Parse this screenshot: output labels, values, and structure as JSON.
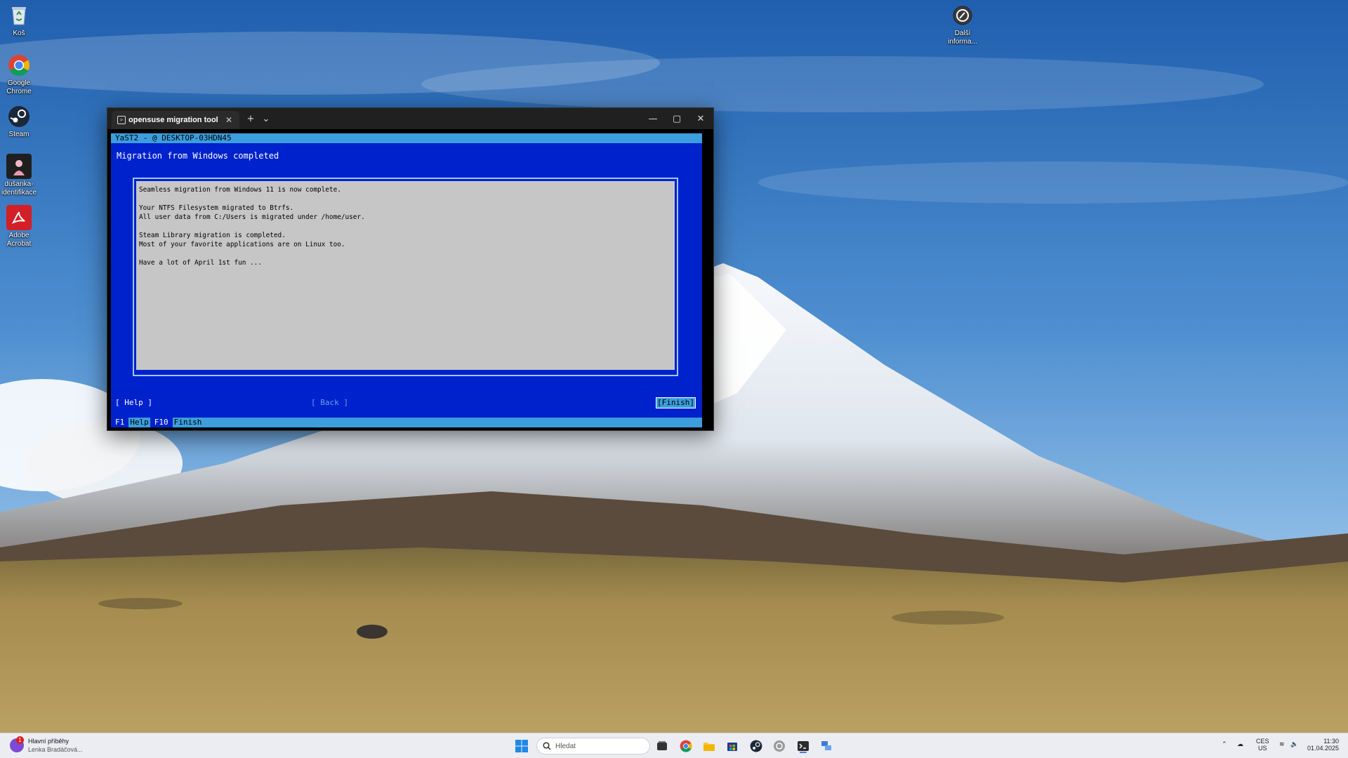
{
  "desktop": {
    "icons": [
      {
        "label": "Koš"
      },
      {
        "label": "Google Chrome"
      },
      {
        "label": "Steam"
      },
      {
        "label": "dušanka- identifikace"
      },
      {
        "label": "Adobe Acrobat"
      },
      {
        "label": "Další informa..."
      }
    ]
  },
  "terminal": {
    "tab_title": "opensuse migration tool",
    "tab_close": "✕",
    "new_tab": "+",
    "tab_dropdown": "⌄",
    "minimize": "—",
    "maximize": "▢",
    "close": "✕"
  },
  "yast": {
    "header": "YaST2 - @ DESKTOP-03HDN45",
    "heading": "Migration from Windows completed",
    "lines": [
      "Seamless migration from Windows 11 is now complete.",
      "",
      "Your NTFS Filesystem migrated to Btrfs.",
      "All user data from C:/Users is migrated under /home/user.",
      "",
      "Steam Library migration is completed.",
      "Most of your favorite applications are on Linux too.",
      "",
      "Have a lot of April 1st fun ..."
    ],
    "buttons": {
      "help": "[ Help ]",
      "back": "[ Back ]",
      "finish": "[Finish]"
    },
    "footer": [
      {
        "key": "F1",
        "label": "Help"
      },
      {
        "key": "F10",
        "label": "Finish"
      }
    ]
  },
  "taskbar": {
    "news_title": "Hlavní příběhy",
    "news_subtitle": "Lenka Bradáčová...",
    "news_badge": "1",
    "search_placeholder": "Hledat",
    "language": "CES",
    "layout": "US",
    "time": "11:30",
    "date": "01.04.2025"
  },
  "colors": {
    "yast_background": "#0022cc",
    "yast_accent": "#3c9edc",
    "yast_box": "#c6c6c6",
    "taskbar": "#ecedf2"
  }
}
